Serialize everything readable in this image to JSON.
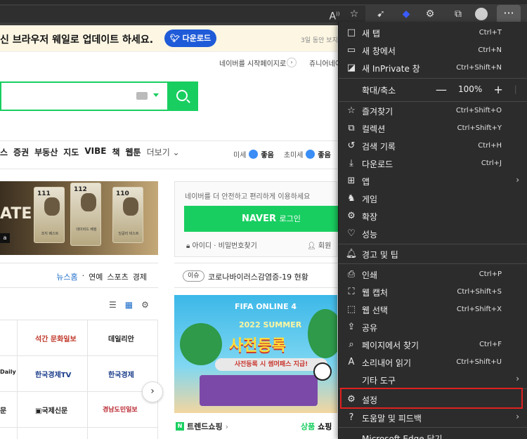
{
  "browser": {
    "read_aloud_icon": "read-aloud-icon",
    "favorite_icon": "add-favorite-icon",
    "more_label": "···"
  },
  "banner": {
    "text": "신 브라우저 웨일로 업데이트 하세요.",
    "button": "다운로드",
    "note": "3일 동안 보지"
  },
  "startpage": {
    "text": "네이버를 시작페이지로",
    "arrow": "›",
    "text2": "쥬니어네이버"
  },
  "nav": {
    "items": [
      "스",
      "증권",
      "부동산",
      "지도",
      "VIBE",
      "책",
      "웹툰"
    ],
    "more": "더보기 ⌄"
  },
  "weather": {
    "fine_dust": "미세",
    "fine_dust_status": "좋음",
    "ultra_fine_dust": "초미세",
    "ultra_fine_dust_status": "좋음"
  },
  "ad": {
    "text": "ATE",
    "cards": [
      {
        "num": "111",
        "name": "조지 베스트"
      },
      {
        "num": "112",
        "name": "데이비드 베컴"
      },
      {
        "num": "110",
        "name": "잉글리 비스트"
      }
    ]
  },
  "login": {
    "hint": "네이버를 더 안전하고 편리하게 이용하세요",
    "brand": "NAVER",
    "button_suffix": "로그인",
    "links": "아이디 · 비밀번호찾기",
    "join": "회원"
  },
  "news": {
    "links": [
      "뉴스홈",
      "연예",
      "스포츠",
      "경제"
    ]
  },
  "issue": {
    "tag": "이슈",
    "text": "코로나바이러스감염증-19 현황"
  },
  "press": {
    "rows": [
      [
        "",
        "석간 문화일보",
        "데일리안"
      ],
      [
        "Daily",
        "한국경제TV",
        "한국경제"
      ],
      [
        "문",
        "국제신문",
        "경남도민일보"
      ]
    ],
    "next": "›"
  },
  "fifa_ad": {
    "logo": "FIFA ONLINE 4",
    "summer": "2022 SUMMER",
    "title": "사전등록",
    "ribbon": "사전등록 시 썸머패스 지급!"
  },
  "trend": {
    "badge": "N",
    "title": "트렌드쇼핑",
    "arrow": "›",
    "tab_active": "상품",
    "tab2": "쇼핑"
  },
  "menu": {
    "items": [
      {
        "icon": "new-tab-icon",
        "glyph": "□",
        "label": "새 탭",
        "shortcut": "Ctrl+T"
      },
      {
        "icon": "new-window-icon",
        "glyph": "▭",
        "label": "새 창에서",
        "shortcut": "Ctrl+N"
      },
      {
        "icon": "inprivate-icon",
        "glyph": "◪",
        "label": "새 InPrivate 창",
        "shortcut": "Ctrl+Shift+N"
      },
      {
        "icon": "zoom-label",
        "glyph": "",
        "label": "확대/축소",
        "shortcut": ""
      },
      {
        "icon": "favorites-icon",
        "glyph": "☆",
        "label": "즐겨찾기",
        "shortcut": "Ctrl+Shift+O"
      },
      {
        "icon": "collections-icon",
        "glyph": "⧉",
        "label": "컬렉션",
        "shortcut": "Ctrl+Shift+Y"
      },
      {
        "icon": "history-icon",
        "glyph": "↺",
        "label": "검색 기록",
        "shortcut": "Ctrl+H"
      },
      {
        "icon": "download-icon",
        "glyph": "⤓",
        "label": "다운로드",
        "shortcut": "Ctrl+J"
      },
      {
        "icon": "apps-icon",
        "glyph": "⊞",
        "label": "앱",
        "shortcut": ""
      },
      {
        "icon": "games-icon",
        "glyph": "♞",
        "label": "게임",
        "shortcut": ""
      },
      {
        "icon": "extensions-icon",
        "glyph": "⚙",
        "label": "확장",
        "shortcut": ""
      },
      {
        "icon": "performance-icon",
        "glyph": "♡",
        "label": "성능",
        "shortcut": ""
      },
      {
        "icon": "alerts-icon",
        "glyph": "🔔︎",
        "label": "경고 및 팁",
        "shortcut": ""
      },
      {
        "icon": "print-icon",
        "glyph": "⎙",
        "label": "인쇄",
        "shortcut": "Ctrl+P"
      },
      {
        "icon": "web-capture-icon",
        "glyph": "⛶",
        "label": "웹 캡처",
        "shortcut": "Ctrl+Shift+S"
      },
      {
        "icon": "web-select-icon",
        "glyph": "⬚",
        "label": "웹 선택",
        "shortcut": "Ctrl+Shift+X"
      },
      {
        "icon": "share-icon",
        "glyph": "⇪",
        "label": "공유",
        "shortcut": ""
      },
      {
        "icon": "find-icon",
        "glyph": "⌕",
        "label": "페이지에서 찾기",
        "shortcut": "Ctrl+F"
      },
      {
        "icon": "read-aloud-icon",
        "glyph": "A",
        "label": "소리내어 읽기",
        "shortcut": "Ctrl+Shift+U"
      },
      {
        "icon": "",
        "glyph": "",
        "label": "기타 도구",
        "shortcut": ""
      },
      {
        "icon": "settings-icon",
        "glyph": "⚙",
        "label": "설정",
        "shortcut": ""
      },
      {
        "icon": "help-icon",
        "glyph": "?",
        "label": "도움말 및 피드백",
        "shortcut": ""
      },
      {
        "icon": "",
        "glyph": "",
        "label": "Microsoft Edge 닫기",
        "shortcut": ""
      }
    ],
    "zoom": {
      "minus": "—",
      "value": "100%",
      "plus": "+",
      "fullscreen": "⤢"
    },
    "highlight_color": "#e02020"
  }
}
